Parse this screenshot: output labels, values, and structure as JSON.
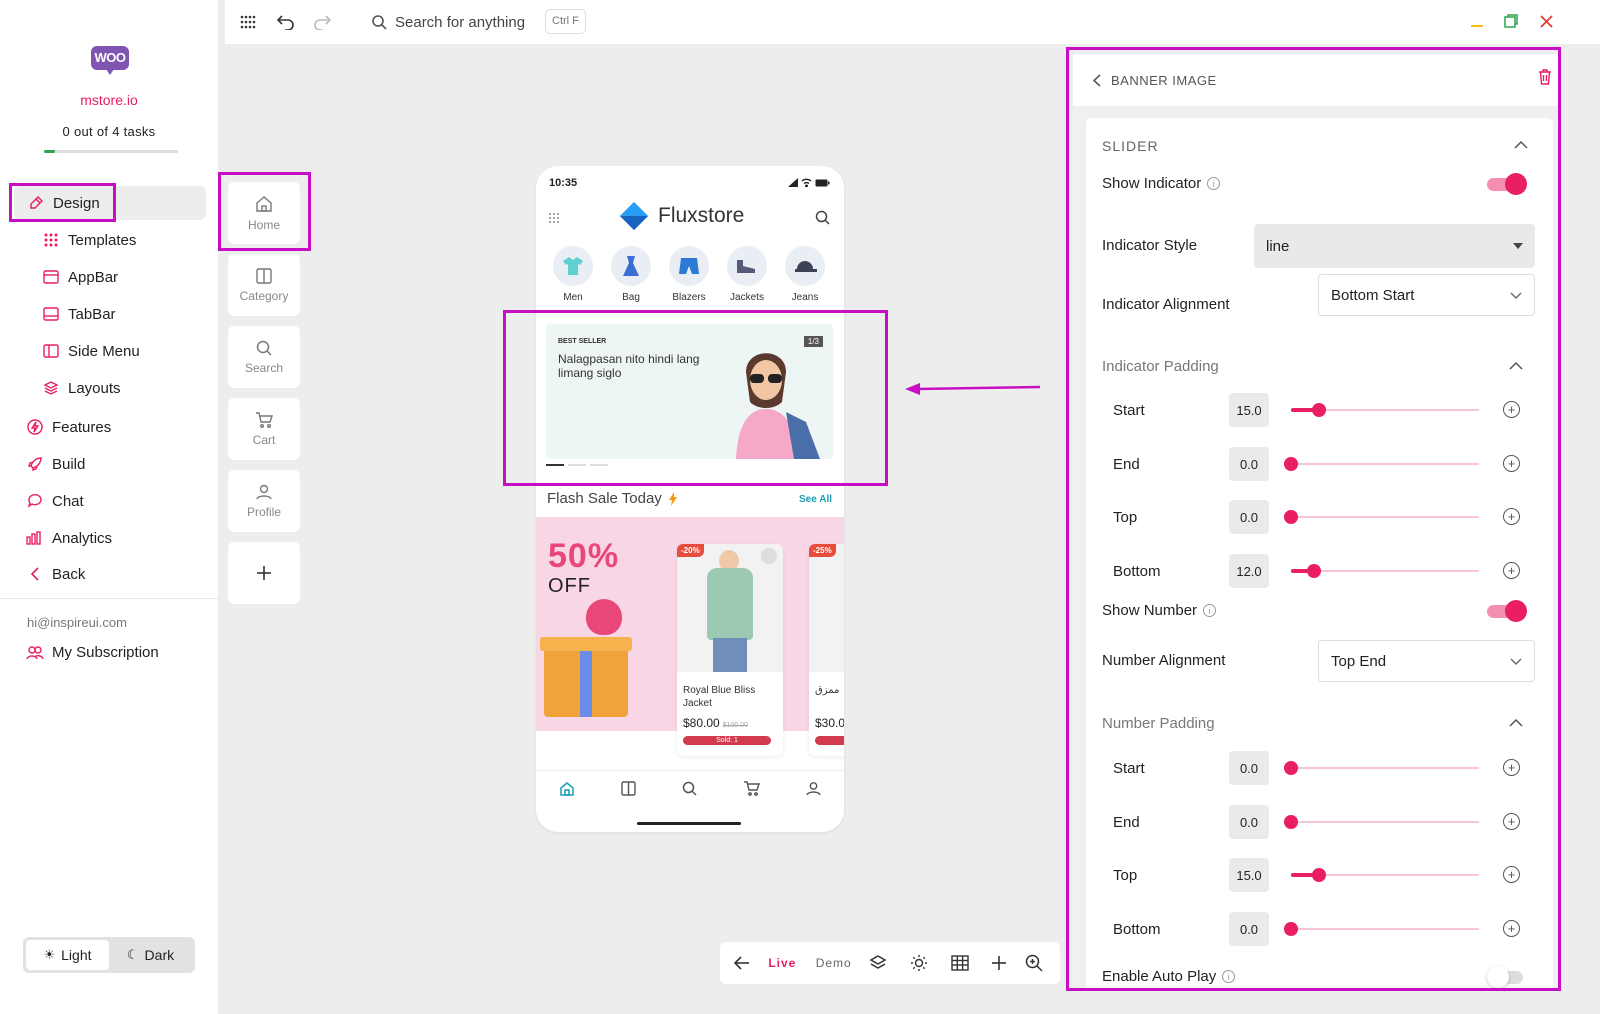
{
  "sidebar": {
    "logo_text": "WOO",
    "store_name": "mstore.io",
    "tasks_text": "0 out of 4 tasks",
    "tasks_progress": 0.08,
    "items": [
      {
        "label": "Design",
        "icon": "brush-icon",
        "active": true
      },
      {
        "label": "Templates",
        "icon": "grid-dots-icon",
        "sub": true
      },
      {
        "label": "AppBar",
        "icon": "appbar-icon",
        "sub": true
      },
      {
        "label": "TabBar",
        "icon": "tabbar-icon",
        "sub": true
      },
      {
        "label": "Side Menu",
        "icon": "side-menu-icon",
        "sub": true
      },
      {
        "label": "Layouts",
        "icon": "layers-icon",
        "sub": true
      },
      {
        "label": "Features",
        "icon": "bolt-icon"
      },
      {
        "label": "Build",
        "icon": "rocket-icon"
      },
      {
        "label": "Chat",
        "icon": "chat-icon"
      },
      {
        "label": "Analytics",
        "icon": "bar-chart-icon"
      },
      {
        "label": "Back",
        "icon": "chevron-left-icon"
      }
    ],
    "email": "hi@inspireui.com",
    "subscription": "My Subscription",
    "theme": {
      "light": "Light",
      "dark": "Dark",
      "selected": "Light"
    }
  },
  "topbar": {
    "search_placeholder": "Search for anything",
    "shortcut": "Ctrl F"
  },
  "tabs": [
    {
      "label": "Home",
      "icon": "home-icon"
    },
    {
      "label": "Category",
      "icon": "category-icon"
    },
    {
      "label": "Search",
      "icon": "search-icon"
    },
    {
      "label": "Cart",
      "icon": "cart-icon"
    },
    {
      "label": "Profile",
      "icon": "profile-icon"
    }
  ],
  "phone": {
    "time": "10:35",
    "brand": "Fluxstore",
    "categories": [
      "Men",
      "Bag",
      "Blazers",
      "Jackets",
      "Jeans"
    ],
    "banner": {
      "tag": "BEST SELLER",
      "headline": "Nalagpasan nito hindi lang limang siglo",
      "number": "1/3"
    },
    "flash_title": "Flash Sale Today",
    "see_all": "See All",
    "promo": {
      "big": "50%",
      "off": "OFF"
    },
    "product": {
      "discount": "-20%",
      "name": "Royal Blue Bliss Jacket",
      "price": "$80.00",
      "old_price": "$100.00",
      "sold": "Sold: 1"
    },
    "product2": {
      "discount": "-25%",
      "name": "ممزق",
      "price": "$30.0"
    }
  },
  "toolbar": {
    "live": "Live",
    "demo": "Demo"
  },
  "panel": {
    "title": "BANNER IMAGE",
    "section": "SLIDER",
    "show_indicator": {
      "label": "Show Indicator",
      "on": true
    },
    "indicator_style": {
      "label": "Indicator Style",
      "value": "line"
    },
    "indicator_alignment": {
      "label": "Indicator Alignment",
      "value": "Bottom Start"
    },
    "indicator_padding": {
      "title": "Indicator Padding",
      "rows": [
        {
          "label": "Start",
          "value": "15.0",
          "fraction": 0.15
        },
        {
          "label": "End",
          "value": "0.0",
          "fraction": 0.0
        },
        {
          "label": "Top",
          "value": "0.0",
          "fraction": 0.0
        },
        {
          "label": "Bottom",
          "value": "12.0",
          "fraction": 0.12
        }
      ]
    },
    "show_number": {
      "label": "Show Number",
      "on": true
    },
    "number_alignment": {
      "label": "Number Alignment",
      "value": "Top End"
    },
    "number_padding": {
      "title": "Number Padding",
      "rows": [
        {
          "label": "Start",
          "value": "0.0",
          "fraction": 0.0
        },
        {
          "label": "End",
          "value": "0.0",
          "fraction": 0.0
        },
        {
          "label": "Top",
          "value": "15.0",
          "fraction": 0.15
        },
        {
          "label": "Bottom",
          "value": "0.0",
          "fraction": 0.0
        }
      ]
    },
    "enable_auto_play": {
      "label": "Enable Auto Play",
      "on": false
    }
  },
  "colors": {
    "accent": "#e91e63",
    "highlight": "#c60fc4",
    "brand_woo": "#7f54b3"
  }
}
